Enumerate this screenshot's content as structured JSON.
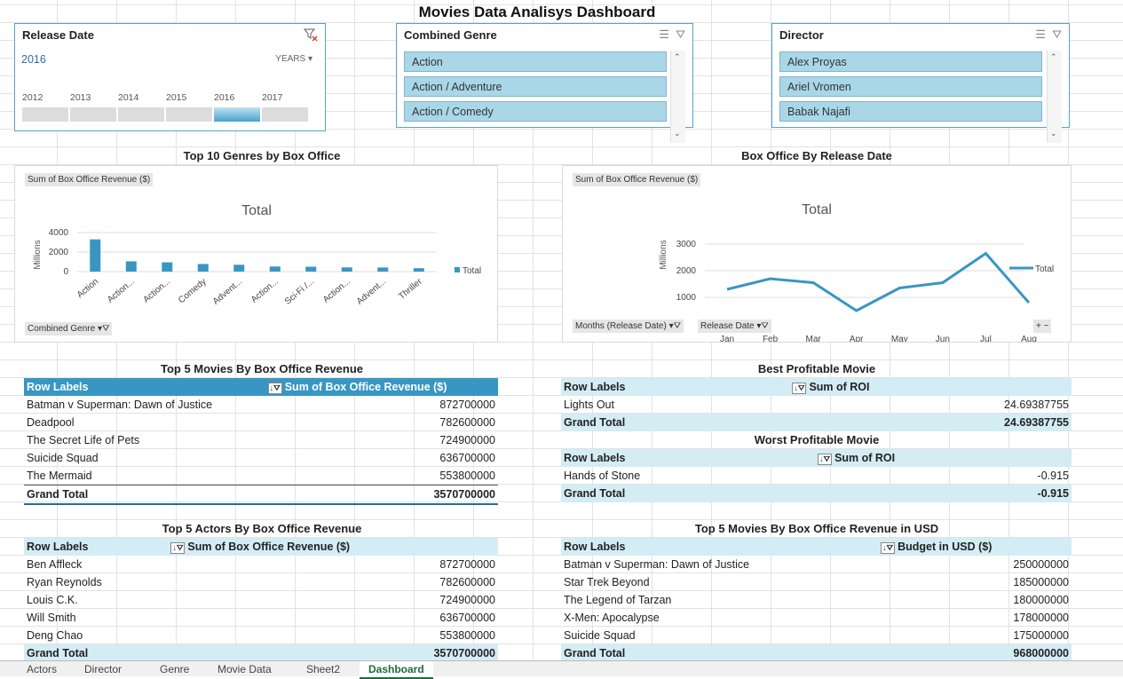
{
  "dashboard_title": "Movies Data Analisys Dashboard",
  "slicers": {
    "release_date": {
      "title": "Release Date",
      "selected": "2016",
      "period": "YEARS",
      "years": [
        "2012",
        "2013",
        "2014",
        "2015",
        "2016",
        "2017"
      ]
    },
    "genre": {
      "title": "Combined Genre",
      "items": [
        "Action",
        "Action / Adventure",
        "Action / Comedy"
      ]
    },
    "director": {
      "title": "Director",
      "items": [
        "Alex Proyas",
        "Ariel Vromen",
        "Babak Najafi"
      ]
    }
  },
  "sections": {
    "top_genres": "Top 10 Genres by Box Office",
    "release_date": "Box Office By Release Date",
    "top_movies": "Top 5 Movies By Box Office Revenue",
    "best": "Best Profitable Movie",
    "worst": "Worst Profitable Movie",
    "top_actors": "Top 5 Actors By Box Office Revenue",
    "top_budget": "Top 5 Movies By Box Office Revenue in USD"
  },
  "chart_data": [
    {
      "type": "bar",
      "title": "Total",
      "ylabel": "Millions",
      "value_field": "Sum of Box Office Revenue ($)",
      "filter_field": "Combined Genre",
      "categories": [
        "Action",
        "Action...",
        "Action...",
        "Comedy",
        "Advent...",
        "Action...",
        "Sci-Fi /...",
        "Action...",
        "Advent...",
        "Thriller"
      ],
      "series": [
        {
          "name": "Total",
          "values": [
            3300,
            1050,
            950,
            780,
            700,
            520,
            500,
            430,
            420,
            350
          ]
        }
      ],
      "ylim": [
        0,
        4000
      ],
      "yticks": [
        "0",
        "2000",
        "4000"
      ],
      "legend": "right",
      "color": "#3897c2"
    },
    {
      "type": "line",
      "title": "Total",
      "ylabel": "Millions",
      "value_field": "Sum of Box Office Revenue ($)",
      "filter_fields": [
        "Months (Release Date)",
        "Release Date"
      ],
      "categories": [
        "Jan",
        "Feb",
        "Mar",
        "Apr",
        "May",
        "Jun",
        "Jul",
        "Aug"
      ],
      "series": [
        {
          "name": "Total",
          "values": [
            1300,
            1700,
            1550,
            500,
            1350,
            1550,
            2650,
            800
          ]
        }
      ],
      "ylim": [
        0,
        3500
      ],
      "yticks": [
        "1000",
        "2000",
        "3000"
      ],
      "legend": "right",
      "color": "#3897c2"
    }
  ],
  "tables": {
    "top_movies": {
      "col1": "Row Labels",
      "col2": "Sum of Box Office Revenue ($)",
      "rows": [
        [
          "Batman v Superman: Dawn of Justice",
          "872700000"
        ],
        [
          "Deadpool",
          "782600000"
        ],
        [
          "The Secret Life of Pets",
          "724900000"
        ],
        [
          "Suicide Squad",
          "636700000"
        ],
        [
          "The Mermaid",
          "553800000"
        ]
      ],
      "total_label": "Grand Total",
      "total": "3570700000"
    },
    "best": {
      "col1": "Row Labels",
      "col2": "Sum of ROI",
      "rows": [
        [
          "Lights Out",
          "24.69387755"
        ]
      ],
      "total_label": "Grand Total",
      "total": "24.69387755"
    },
    "worst": {
      "col1": "Row Labels",
      "col2": "Sum of ROI",
      "rows": [
        [
          "Hands of Stone",
          "-0.915"
        ]
      ],
      "total_label": "Grand Total",
      "total": "-0.915"
    },
    "top_actors": {
      "col1": "Row Labels",
      "col2": "Sum of Box Office Revenue ($)",
      "rows": [
        [
          "Ben Affleck",
          "872700000"
        ],
        [
          "Ryan Reynolds",
          "782600000"
        ],
        [
          "Louis C.K.",
          "724900000"
        ],
        [
          "Will Smith",
          "636700000"
        ],
        [
          "Deng Chao",
          "553800000"
        ]
      ],
      "total_label": "Grand Total",
      "total": "3570700000"
    },
    "top_budget": {
      "col1": "Row Labels",
      "col2": "Budget in USD ($)",
      "rows": [
        [
          "Batman v Superman: Dawn of Justice",
          "250000000"
        ],
        [
          "Star Trek Beyond",
          "185000000"
        ],
        [
          "The Legend of Tarzan",
          "180000000"
        ],
        [
          "X-Men: Apocalypse",
          "178000000"
        ],
        [
          "Suicide Squad",
          "175000000"
        ]
      ],
      "total_label": "Grand Total",
      "total": "968000000"
    }
  },
  "sheet_tabs": [
    "Actors",
    "Director",
    "Genre",
    "Movie Data",
    "Sheet2",
    "Dashboard"
  ],
  "active_tab": "Dashboard",
  "icons": {
    "filter": "filter-icon",
    "multiselect": "multiselect-icon",
    "clear": "clear-filter-icon"
  }
}
